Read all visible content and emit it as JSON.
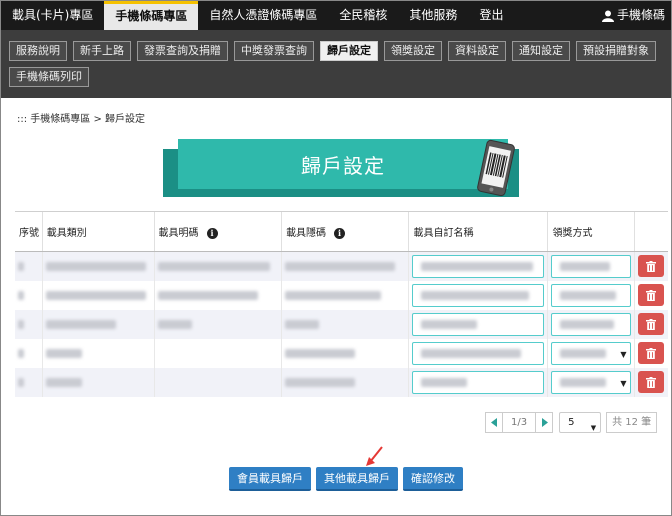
{
  "topnav": {
    "items": [
      "載具(卡片)專區",
      "手機條碼專區",
      "自然人憑證條碼專區",
      "全民稽核",
      "其他服務",
      "登出"
    ],
    "active_index": 1,
    "user_label": "手機條碼"
  },
  "subnav": {
    "row1": [
      "服務說明",
      "新手上路",
      "發票查詢及捐贈",
      "中獎發票查詢",
      "歸戶設定",
      "領獎設定",
      "資料設定",
      "通知設定",
      "預設捐贈對象"
    ],
    "row2": [
      "手機條碼列印"
    ],
    "active": "歸戶設定"
  },
  "breadcrumb": "::: 手機條碼專區 > 歸戶設定",
  "banner": {
    "title": "歸戶設定"
  },
  "table": {
    "headers": [
      "序號",
      "載具類別",
      "載具明碼",
      "載具隱碼",
      "載具自訂名稱",
      "領獎方式"
    ]
  },
  "pager": {
    "page": "1/3",
    "page_size": "5",
    "total": "共 12 筆"
  },
  "actions": {
    "member": "會員載具歸戶",
    "other": "其他載具歸戶",
    "confirm": "確認修改"
  },
  "colors": {
    "teal": "#2fb9ab",
    "teal_dark": "#1b8f85",
    "delete": "#d9534f",
    "primary": "#2f7fc4",
    "nav_accent": "#f5c100"
  }
}
